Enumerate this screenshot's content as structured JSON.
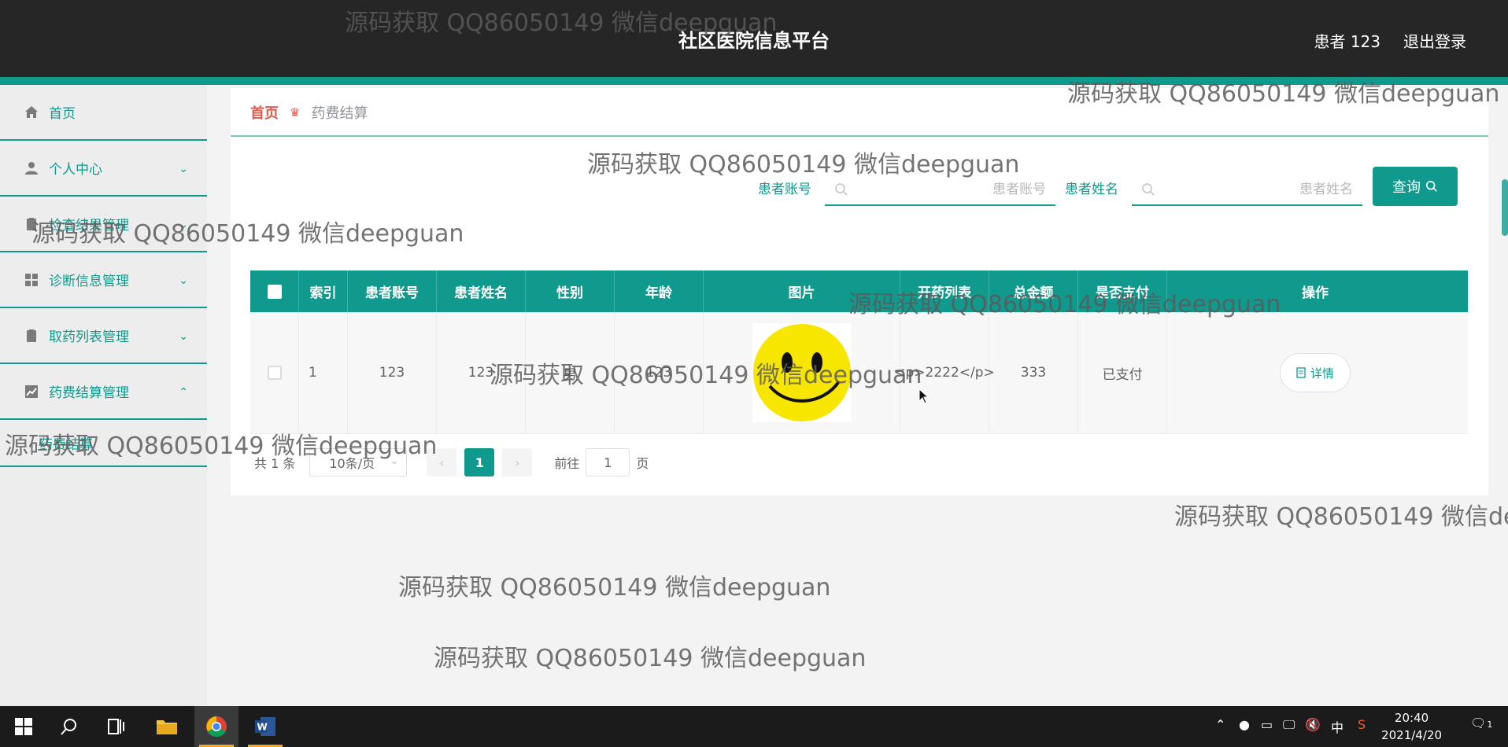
{
  "header": {
    "title": "社区医院信息平台",
    "user": "患者 123",
    "logout": "退出登录"
  },
  "sidebar": {
    "items": [
      {
        "label": "首页",
        "icon": "home-icon",
        "expandable": false
      },
      {
        "label": "个人中心",
        "icon": "user-icon",
        "expandable": true
      },
      {
        "label": "检查结果管理",
        "icon": "clipboard-icon",
        "expandable": true
      },
      {
        "label": "诊断信息管理",
        "icon": "grid-icon",
        "expandable": true
      },
      {
        "label": "取药列表管理",
        "icon": "clipboard-icon",
        "expandable": true
      },
      {
        "label": "药费结算管理",
        "icon": "chart-icon",
        "expandable": true,
        "expanded": true
      }
    ],
    "submenu": {
      "label": "药费结算"
    }
  },
  "breadcrumb": {
    "home": "首页",
    "current": "药费结算"
  },
  "search": {
    "account_label": "患者账号",
    "account_placeholder": "患者账号",
    "name_label": "患者姓名",
    "name_placeholder": "患者姓名",
    "query_button": "查询"
  },
  "table": {
    "columns": [
      "索引",
      "患者账号",
      "患者姓名",
      "性别",
      "年龄",
      "图片",
      "开药列表",
      "总金额",
      "是否支付",
      "操作"
    ],
    "rows": [
      {
        "index": "1",
        "account": "123",
        "name": "123",
        "gender": "男",
        "age": "123",
        "drugs": "<p>2222</p>",
        "total": "333",
        "paid": "已支付",
        "action": "详情"
      }
    ]
  },
  "pagination": {
    "total": "共 1 条",
    "page_size": "10条/页",
    "current": "1",
    "goto_label": "前往",
    "goto_value": "1",
    "page_unit": "页"
  },
  "watermark": "源码获取 QQ86050149 微信deepguan",
  "taskbar": {
    "time": "20:40",
    "date": "2021/4/20",
    "ime": "中",
    "notifications": "1"
  },
  "colors": {
    "accent": "#0f9a8d",
    "header_bg": "#262626",
    "breadcrumb_home": "#e05a4d"
  }
}
